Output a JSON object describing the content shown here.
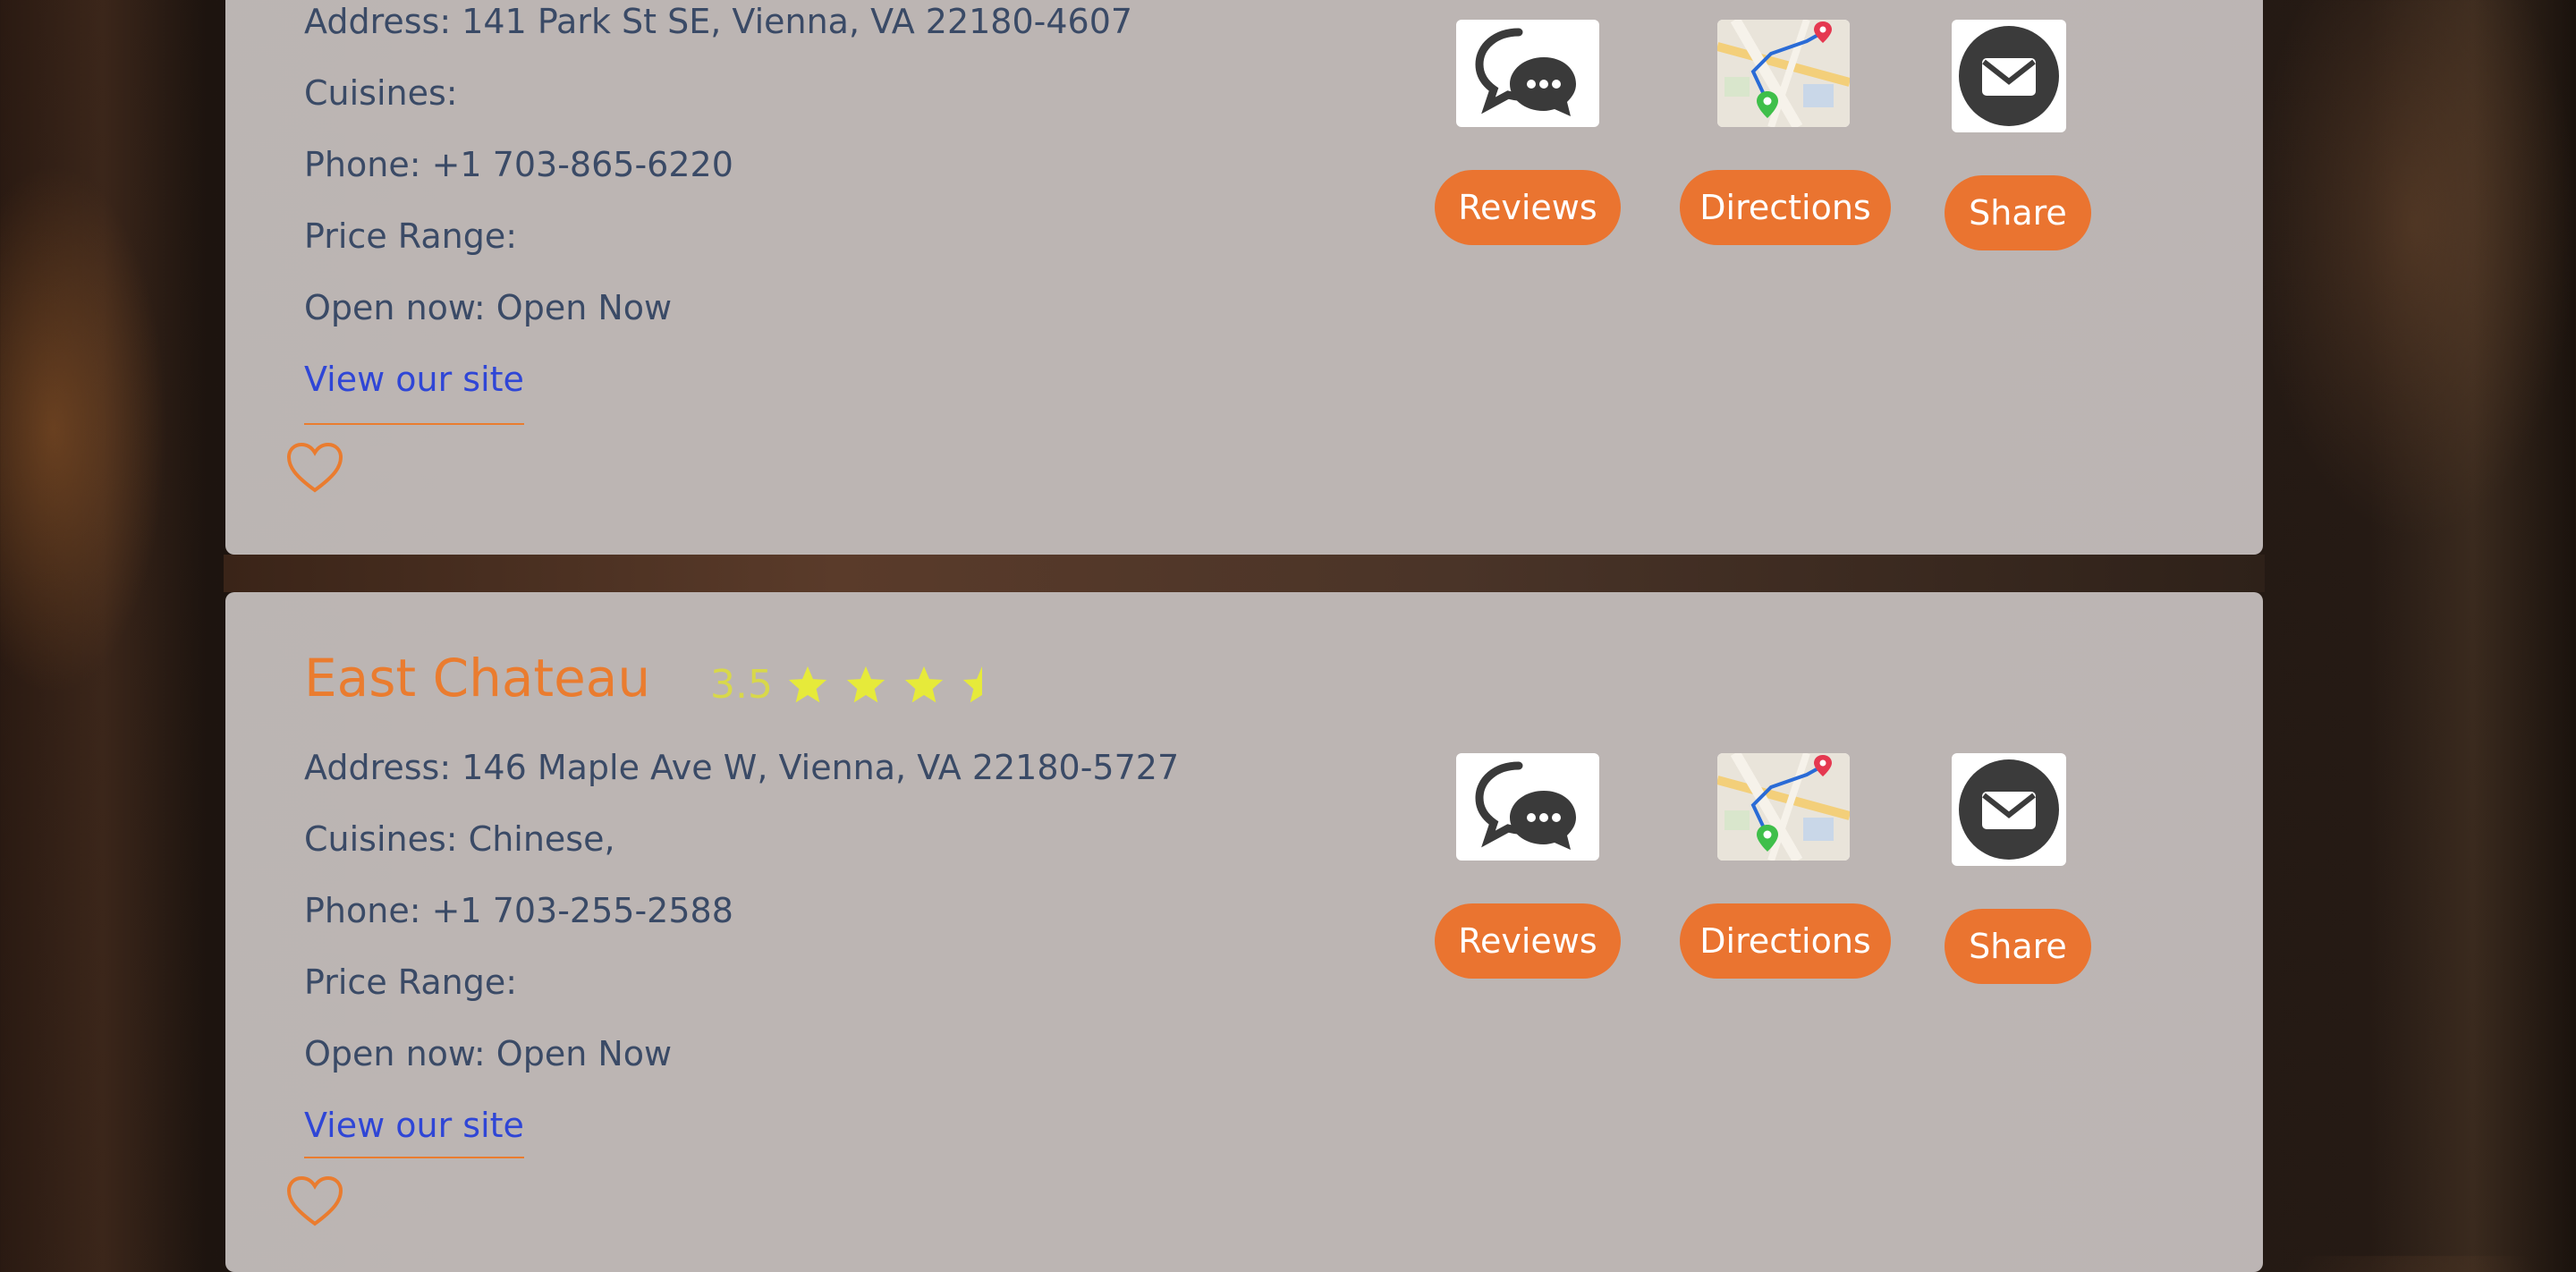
{
  "restaurants": [
    {
      "address": "Address: 141 Park St SE, Vienna, VA 22180-4607",
      "cuisines": "Cuisines:",
      "phone": "Phone: +1 703-865-6220",
      "price_range": "Price Range:",
      "open_now": "Open now: Open Now",
      "site_link": "View our site",
      "buttons": {
        "reviews": "Reviews",
        "directions": "Directions",
        "share": "Share"
      }
    },
    {
      "name": "East Chateau",
      "rating": "3.5",
      "rating_value": 3.5,
      "address": "Address: 146 Maple Ave W, Vienna, VA 22180-5727",
      "cuisines": "Cuisines: Chinese,",
      "phone": "Phone: +1 703-255-2588",
      "price_range": "Price Range:",
      "open_now": "Open now: Open Now",
      "site_link": "View our site",
      "buttons": {
        "reviews": "Reviews",
        "directions": "Directions",
        "share": "Share"
      }
    }
  ],
  "icons": {
    "reviews": "chat-bubbles-icon",
    "directions": "map-route-icon",
    "share": "email-envelope-icon",
    "favorite": "heart-outline-icon",
    "rating": "star-icon"
  },
  "colors": {
    "accent_orange": "#ea7430",
    "title_orange": "#ea7c2f",
    "star_yellow": "#e6ea3a",
    "link_blue": "#2f46d6",
    "text_slate": "#3a4a66"
  }
}
